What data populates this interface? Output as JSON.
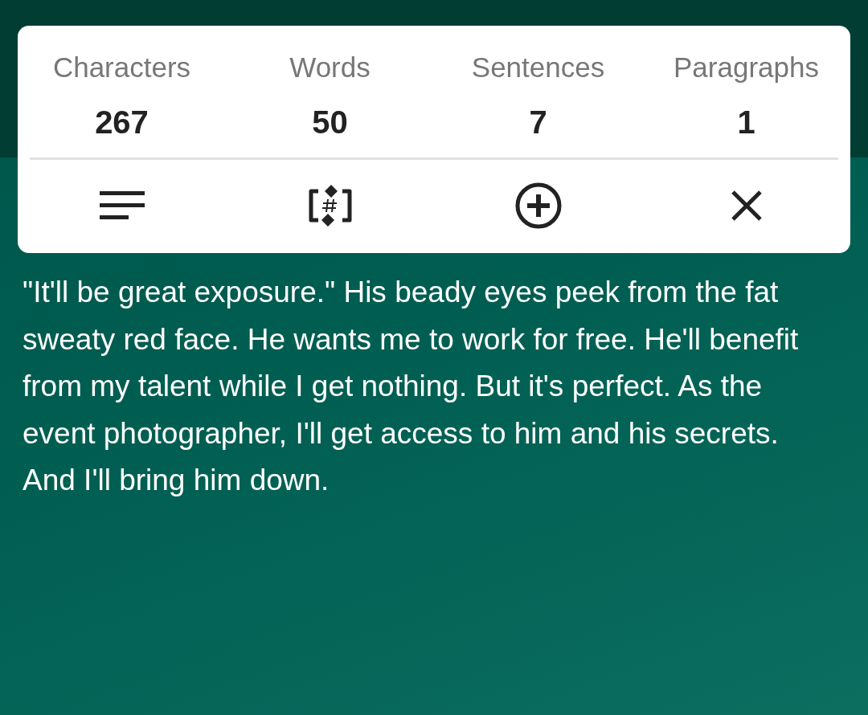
{
  "stats": [
    {
      "label": "Characters",
      "value": "267"
    },
    {
      "label": "Words",
      "value": "50"
    },
    {
      "label": "Sentences",
      "value": "7"
    },
    {
      "label": "Paragraphs",
      "value": "1"
    }
  ],
  "actions": [
    {
      "kind": "lines"
    },
    {
      "kind": "hash"
    },
    {
      "kind": "add"
    },
    {
      "kind": "close"
    }
  ],
  "text": "\"It'll be great exposure.\" His beady eyes peek from the fat sweaty red face. He wants me to work for free. He'll benefit from my talent while I get nothing. But it's perfect. As the event photographer, I'll get access to him and his secrets. And I'll bring him down."
}
